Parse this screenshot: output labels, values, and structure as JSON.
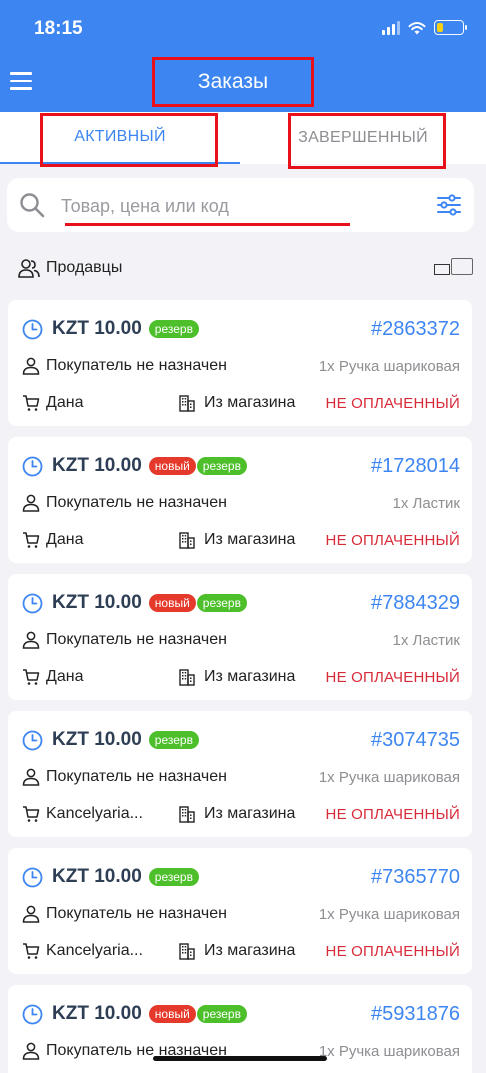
{
  "status_bar": {
    "time": "18:15"
  },
  "header": {
    "title": "Заказы"
  },
  "tabs": [
    {
      "label": "АКТИВНЫЙ",
      "active": true
    },
    {
      "label": "ЗАВЕРШЕННЫЙ",
      "active": false
    }
  ],
  "search": {
    "placeholder": "Товар, цена или код"
  },
  "sellers": {
    "label": "Продавцы"
  },
  "colors": {
    "accent": "#3d86f2",
    "badge_new": "#e53a2b",
    "badge_reserve": "#4cbf2a",
    "unpaid": "#d82b3a",
    "annotation": "#e8101a"
  },
  "orders": [
    {
      "price": "KZT 10.00",
      "badges": [
        "резерв"
      ],
      "id": "#2863372",
      "buyer": "Покупатель не назначен",
      "item": "1x Ручка шариковая",
      "seller": "Дана",
      "source": "Из магазина",
      "payment": "НЕ ОПЛАЧЕННЫЙ"
    },
    {
      "price": "KZT 10.00",
      "badges": [
        "новый",
        "резерв"
      ],
      "id": "#1728014",
      "buyer": "Покупатель не назначен",
      "item": "1x Ластик",
      "seller": "Дана",
      "source": "Из магазина",
      "payment": "НЕ ОПЛАЧЕННЫЙ"
    },
    {
      "price": "KZT 10.00",
      "badges": [
        "новый",
        "резерв"
      ],
      "id": "#7884329",
      "buyer": "Покупатель не назначен",
      "item": "1x Ластик",
      "seller": "Дана",
      "source": "Из магазина",
      "payment": "НЕ ОПЛАЧЕННЫЙ"
    },
    {
      "price": "KZT 10.00",
      "badges": [
        "резерв"
      ],
      "id": "#3074735",
      "buyer": "Покупатель не назначен",
      "item": "1x Ручка шариковая",
      "seller": "Kancelyaria...",
      "source": "Из магазина",
      "payment": "НЕ ОПЛАЧЕННЫЙ"
    },
    {
      "price": "KZT 10.00",
      "badges": [
        "резерв"
      ],
      "id": "#7365770",
      "buyer": "Покупатель не назначен",
      "item": "1x Ручка шариковая",
      "seller": "Kancelyaria...",
      "source": "Из магазина",
      "payment": "НЕ ОПЛАЧЕННЫЙ"
    },
    {
      "price": "KZT 10.00",
      "badges": [
        "новый",
        "резерв"
      ],
      "id": "#5931876",
      "buyer": "Покупатель не назначен",
      "item": "1x Ручка шариковая",
      "seller": "",
      "source": "",
      "payment": ""
    }
  ]
}
